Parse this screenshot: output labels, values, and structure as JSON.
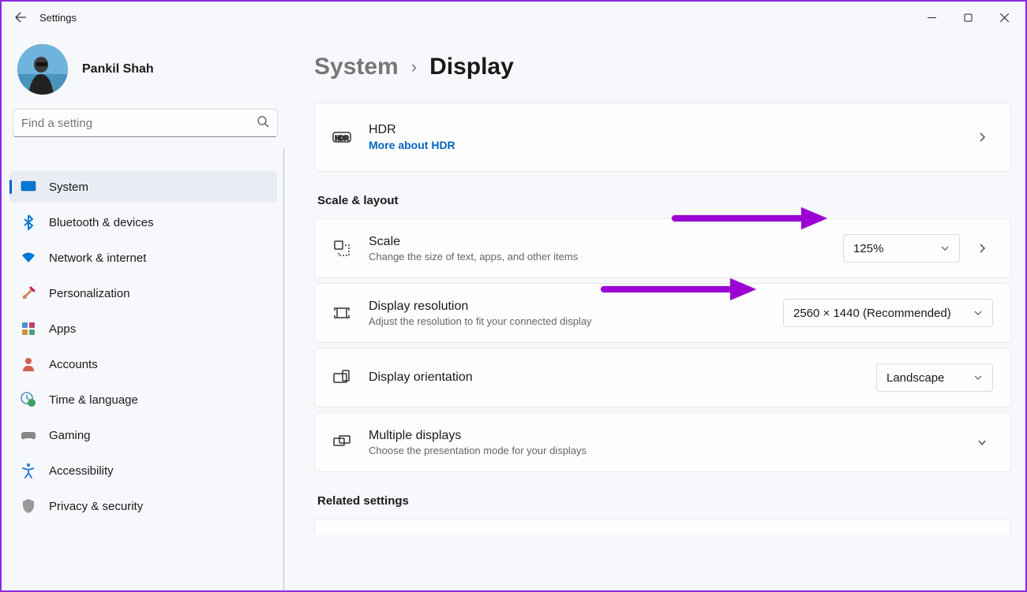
{
  "window": {
    "title": "Settings"
  },
  "profile": {
    "name": "Pankil Shah"
  },
  "search": {
    "placeholder": "Find a setting"
  },
  "sidebar": {
    "items": [
      {
        "label": "System"
      },
      {
        "label": "Bluetooth & devices"
      },
      {
        "label": "Network & internet"
      },
      {
        "label": "Personalization"
      },
      {
        "label": "Apps"
      },
      {
        "label": "Accounts"
      },
      {
        "label": "Time & language"
      },
      {
        "label": "Gaming"
      },
      {
        "label": "Accessibility"
      },
      {
        "label": "Privacy & security"
      }
    ]
  },
  "breadcrumb": {
    "parent": "System",
    "current": "Display"
  },
  "hdr": {
    "title": "HDR",
    "link": "More about HDR"
  },
  "sections": {
    "scale_layout": "Scale & layout",
    "related": "Related settings"
  },
  "cards": {
    "scale": {
      "title": "Scale",
      "sub": "Change the size of text, apps, and other items",
      "value": "125%"
    },
    "resolution": {
      "title": "Display resolution",
      "sub": "Adjust the resolution to fit your connected display",
      "value": "2560 × 1440 (Recommended)"
    },
    "orientation": {
      "title": "Display orientation",
      "value": "Landscape"
    },
    "multiple": {
      "title": "Multiple displays",
      "sub": "Choose the presentation mode for your displays"
    }
  },
  "colors": {
    "accent": "#0067c0",
    "annotation": "#9b00d4"
  }
}
